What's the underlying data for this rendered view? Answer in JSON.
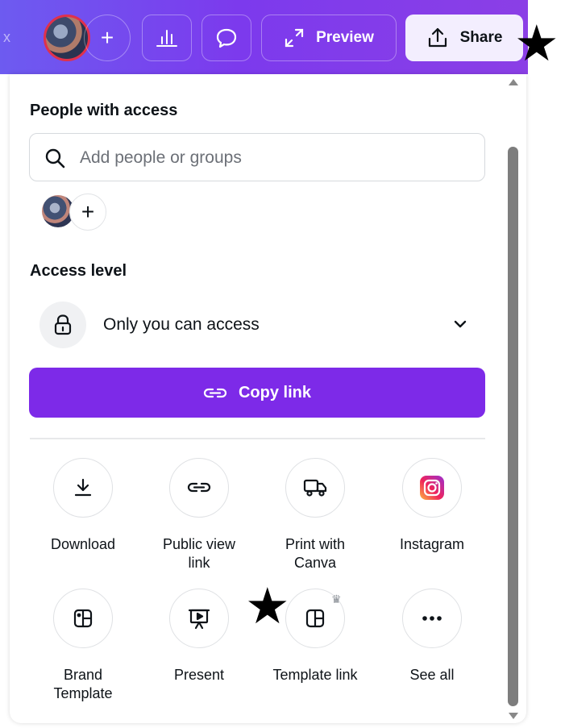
{
  "topbar": {
    "preview_label": "Preview",
    "share_label": "Share"
  },
  "panel": {
    "people_heading": "People with access",
    "search_placeholder": "Add people or groups",
    "access_heading": "Access level",
    "access_value": "Only you can access",
    "copy_link_label": "Copy link"
  },
  "options": [
    {
      "label": "Download",
      "icon": "download-icon"
    },
    {
      "label": "Public view link",
      "icon": "link-icon"
    },
    {
      "label": "Print with Canva",
      "icon": "truck-icon"
    },
    {
      "label": "Instagram",
      "icon": "instagram-icon"
    },
    {
      "label": "Brand Template",
      "icon": "brand-template-icon"
    },
    {
      "label": "Present",
      "icon": "present-icon"
    },
    {
      "label": "Template link",
      "icon": "template-link-icon",
      "premium": true
    },
    {
      "label": "See all",
      "icon": "more-icon"
    }
  ],
  "colors": {
    "accent": "#7d2ae8",
    "topbar_start": "#6d5bf0",
    "topbar_end": "#8b3fe6"
  }
}
